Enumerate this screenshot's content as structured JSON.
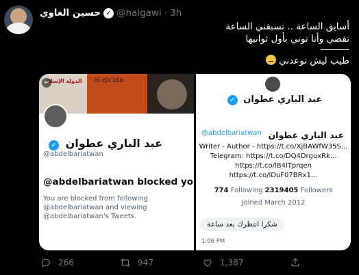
{
  "tweet": {
    "author_name": "حسين الغاوي",
    "handle": "@halgawi",
    "separator": "·",
    "time": "3h",
    "text_line1": "أسابق الساعة .. تسبقني الساعة",
    "text_line2": "تقضي وأنا توني بأول ثوانيها",
    "text_line3": "طيب ليش توعدني"
  },
  "media": {
    "left": {
      "banner_text_1": "الدولة الإسلا",
      "banner_text_2": "al-qa'ida",
      "name": "عبد الباري عطوان",
      "handle": "@abdelbariatwan",
      "blocked_title": "@abdelbariatwan blocked you",
      "blocked_desc": "You are blocked from following @abdelbariatwan and viewing @abdelbariatwan's Tweets."
    },
    "right": {
      "name": "عبد الباري عطوان",
      "card_name": "عبد الباري عطوان",
      "card_handle": "@abdelbariatwan",
      "bio_line1": "Writer - Author - https://t.co/XjBAWfW35S...",
      "bio_line2": "Telegram: https://t.co/DQ4DrguxRk...",
      "bio_line3": "https://t.co/lB4lTprqen",
      "bio_line4": "https://t.co/lDuF07BRx1...",
      "following_count": "774",
      "following_label": "Following",
      "followers_count": "2319405",
      "followers_label": "Followers",
      "joined": "Joined March 2012",
      "message": "شكرا انتظرك بعد ساعة",
      "message_time": "1:06 PM"
    }
  },
  "actions": {
    "replies": "266",
    "retweets": "947",
    "likes": "1,387"
  },
  "colors": {
    "background": "#000000",
    "muted": "#71767b",
    "link": "#1d9bf0"
  }
}
